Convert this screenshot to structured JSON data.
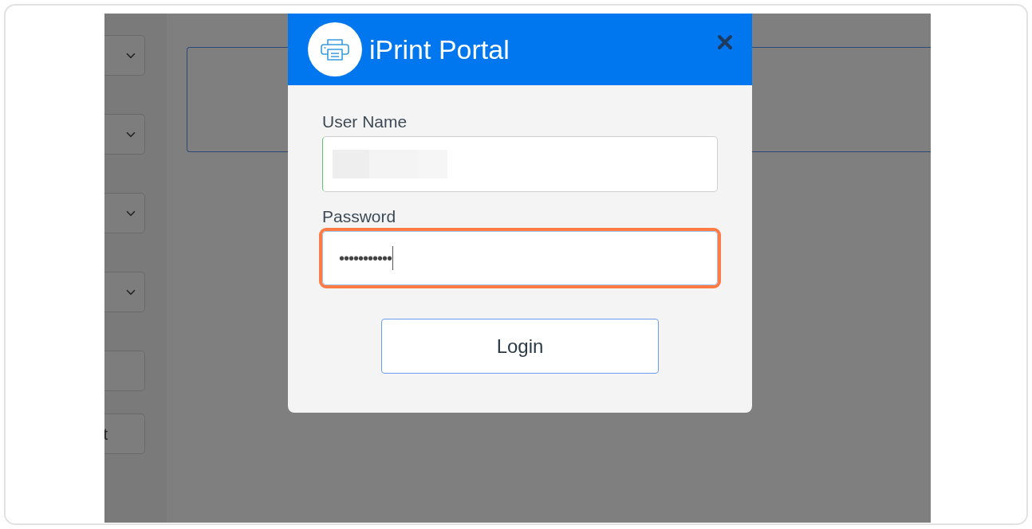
{
  "background_page": {
    "left_panel": {
      "items": [
        {
          "kind": "dropdown"
        },
        {
          "kind": "dropdown"
        },
        {
          "kind": "dropdown"
        },
        {
          "kind": "dropdown"
        },
        {
          "kind": "box"
        },
        {
          "kind": "box",
          "text": "t"
        }
      ]
    }
  },
  "dialog": {
    "title": "iPrint Portal",
    "fields": [
      {
        "label": "User Name",
        "kind": "redacted",
        "highlighted": false
      },
      {
        "label": "Password",
        "kind": "password",
        "value": "•••••••••••",
        "highlighted": true
      }
    ],
    "button": "Login"
  }
}
